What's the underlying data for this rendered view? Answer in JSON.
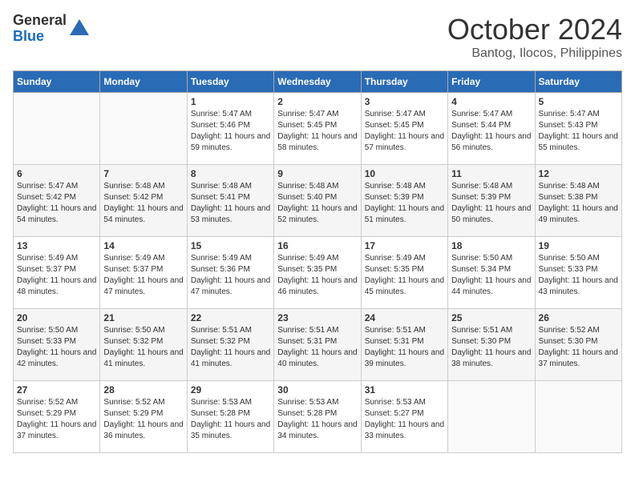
{
  "header": {
    "logo_general": "General",
    "logo_blue": "Blue",
    "month": "October 2024",
    "location": "Bantog, Ilocos, Philippines"
  },
  "days_of_week": [
    "Sunday",
    "Monday",
    "Tuesday",
    "Wednesday",
    "Thursday",
    "Friday",
    "Saturday"
  ],
  "weeks": [
    [
      {
        "day": "",
        "info": ""
      },
      {
        "day": "",
        "info": ""
      },
      {
        "day": "1",
        "info": "Sunrise: 5:47 AM\nSunset: 5:46 PM\nDaylight: 11 hours and 59 minutes."
      },
      {
        "day": "2",
        "info": "Sunrise: 5:47 AM\nSunset: 5:45 PM\nDaylight: 11 hours and 58 minutes."
      },
      {
        "day": "3",
        "info": "Sunrise: 5:47 AM\nSunset: 5:45 PM\nDaylight: 11 hours and 57 minutes."
      },
      {
        "day": "4",
        "info": "Sunrise: 5:47 AM\nSunset: 5:44 PM\nDaylight: 11 hours and 56 minutes."
      },
      {
        "day": "5",
        "info": "Sunrise: 5:47 AM\nSunset: 5:43 PM\nDaylight: 11 hours and 55 minutes."
      }
    ],
    [
      {
        "day": "6",
        "info": "Sunrise: 5:47 AM\nSunset: 5:42 PM\nDaylight: 11 hours and 54 minutes."
      },
      {
        "day": "7",
        "info": "Sunrise: 5:48 AM\nSunset: 5:42 PM\nDaylight: 11 hours and 54 minutes."
      },
      {
        "day": "8",
        "info": "Sunrise: 5:48 AM\nSunset: 5:41 PM\nDaylight: 11 hours and 53 minutes."
      },
      {
        "day": "9",
        "info": "Sunrise: 5:48 AM\nSunset: 5:40 PM\nDaylight: 11 hours and 52 minutes."
      },
      {
        "day": "10",
        "info": "Sunrise: 5:48 AM\nSunset: 5:39 PM\nDaylight: 11 hours and 51 minutes."
      },
      {
        "day": "11",
        "info": "Sunrise: 5:48 AM\nSunset: 5:39 PM\nDaylight: 11 hours and 50 minutes."
      },
      {
        "day": "12",
        "info": "Sunrise: 5:48 AM\nSunset: 5:38 PM\nDaylight: 11 hours and 49 minutes."
      }
    ],
    [
      {
        "day": "13",
        "info": "Sunrise: 5:49 AM\nSunset: 5:37 PM\nDaylight: 11 hours and 48 minutes."
      },
      {
        "day": "14",
        "info": "Sunrise: 5:49 AM\nSunset: 5:37 PM\nDaylight: 11 hours and 47 minutes."
      },
      {
        "day": "15",
        "info": "Sunrise: 5:49 AM\nSunset: 5:36 PM\nDaylight: 11 hours and 47 minutes."
      },
      {
        "day": "16",
        "info": "Sunrise: 5:49 AM\nSunset: 5:35 PM\nDaylight: 11 hours and 46 minutes."
      },
      {
        "day": "17",
        "info": "Sunrise: 5:49 AM\nSunset: 5:35 PM\nDaylight: 11 hours and 45 minutes."
      },
      {
        "day": "18",
        "info": "Sunrise: 5:50 AM\nSunset: 5:34 PM\nDaylight: 11 hours and 44 minutes."
      },
      {
        "day": "19",
        "info": "Sunrise: 5:50 AM\nSunset: 5:33 PM\nDaylight: 11 hours and 43 minutes."
      }
    ],
    [
      {
        "day": "20",
        "info": "Sunrise: 5:50 AM\nSunset: 5:33 PM\nDaylight: 11 hours and 42 minutes."
      },
      {
        "day": "21",
        "info": "Sunrise: 5:50 AM\nSunset: 5:32 PM\nDaylight: 11 hours and 41 minutes."
      },
      {
        "day": "22",
        "info": "Sunrise: 5:51 AM\nSunset: 5:32 PM\nDaylight: 11 hours and 41 minutes."
      },
      {
        "day": "23",
        "info": "Sunrise: 5:51 AM\nSunset: 5:31 PM\nDaylight: 11 hours and 40 minutes."
      },
      {
        "day": "24",
        "info": "Sunrise: 5:51 AM\nSunset: 5:31 PM\nDaylight: 11 hours and 39 minutes."
      },
      {
        "day": "25",
        "info": "Sunrise: 5:51 AM\nSunset: 5:30 PM\nDaylight: 11 hours and 38 minutes."
      },
      {
        "day": "26",
        "info": "Sunrise: 5:52 AM\nSunset: 5:30 PM\nDaylight: 11 hours and 37 minutes."
      }
    ],
    [
      {
        "day": "27",
        "info": "Sunrise: 5:52 AM\nSunset: 5:29 PM\nDaylight: 11 hours and 37 minutes."
      },
      {
        "day": "28",
        "info": "Sunrise: 5:52 AM\nSunset: 5:29 PM\nDaylight: 11 hours and 36 minutes."
      },
      {
        "day": "29",
        "info": "Sunrise: 5:53 AM\nSunset: 5:28 PM\nDaylight: 11 hours and 35 minutes."
      },
      {
        "day": "30",
        "info": "Sunrise: 5:53 AM\nSunset: 5:28 PM\nDaylight: 11 hours and 34 minutes."
      },
      {
        "day": "31",
        "info": "Sunrise: 5:53 AM\nSunset: 5:27 PM\nDaylight: 11 hours and 33 minutes."
      },
      {
        "day": "",
        "info": ""
      },
      {
        "day": "",
        "info": ""
      }
    ]
  ]
}
